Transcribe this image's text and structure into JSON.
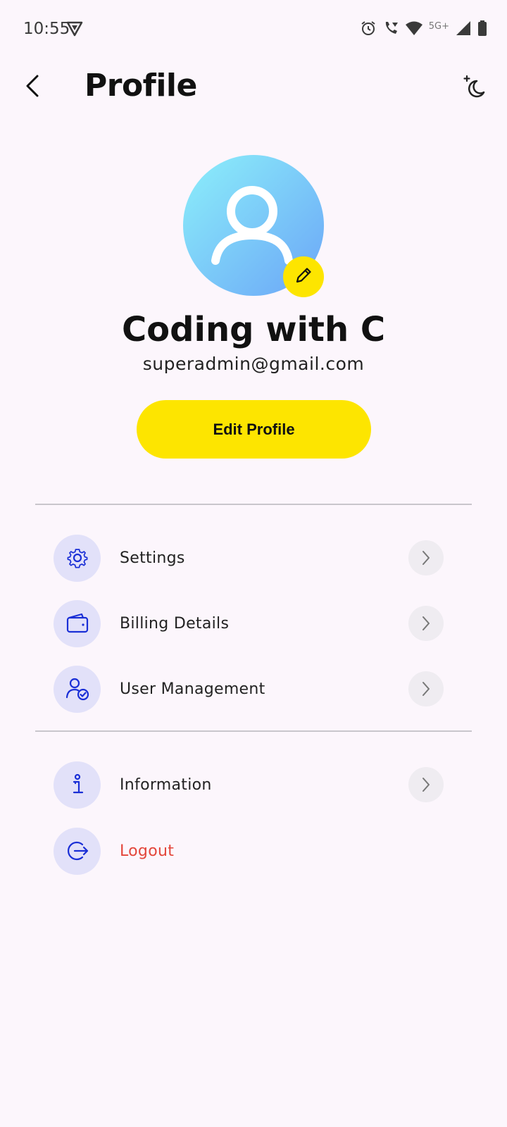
{
  "status_bar": {
    "time": "10:55",
    "network": "5G+",
    "icons": [
      "vpn-shield-icon",
      "alarm-icon",
      "wifi-call-icon",
      "wifi-icon",
      "signal-icon",
      "battery-icon"
    ]
  },
  "header": {
    "title": "Profile",
    "back_icon": "back-arrow-icon",
    "theme_icon": "dark-mode-icon"
  },
  "profile": {
    "name": "Coding with C",
    "email": "superadmin@gmail.com",
    "avatar_gradient": [
      "#8cf0fa",
      "#6ba5f7"
    ],
    "edit_button_label": "Edit Profile"
  },
  "menu": {
    "group1": [
      {
        "label": "Settings",
        "icon": "gear-icon"
      },
      {
        "label": "Billing Details",
        "icon": "wallet-icon"
      },
      {
        "label": "User Management",
        "icon": "user-check-icon"
      }
    ],
    "group2": [
      {
        "label": "Information",
        "icon": "info-icon"
      },
      {
        "label": "Logout",
        "icon": "logout-icon"
      }
    ]
  },
  "colors": {
    "background": "#fcf6fc",
    "accent_yellow": "#fde500",
    "icon_blue": "#1a2fd6",
    "icon_circle": "#e2e1f9",
    "danger": "#e3463b"
  }
}
